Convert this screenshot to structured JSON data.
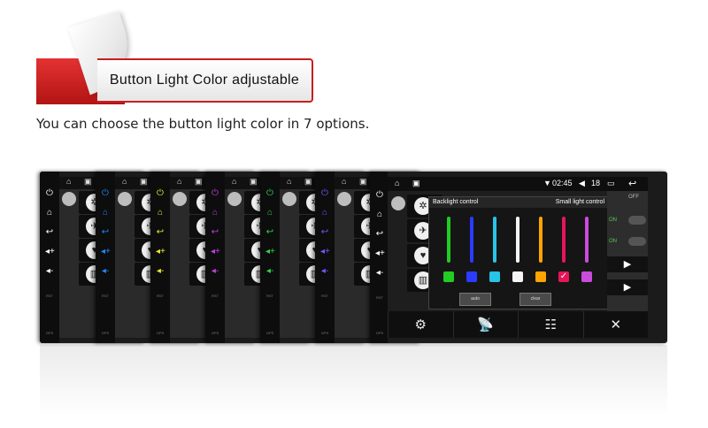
{
  "banner": {
    "title": "Button Light Color adjustable"
  },
  "subtitle": "You can choose the button light color in 7 options.",
  "button_light_colors": [
    "#ffffff",
    "#1e88ff",
    "#e8e832",
    "#c040e0",
    "#33d24a",
    "#6a5cff",
    "#ffffff"
  ],
  "bezel_labels": {
    "reset": "RST",
    "gps": "GPS"
  },
  "front_screen": {
    "status": {
      "time": "02:45",
      "volume": "18"
    },
    "dialog": {
      "title": "Backlight control",
      "mode": "Small light control",
      "bar_colors": [
        "#22cc22",
        "#2b3bff",
        "#27c4e6",
        "#f5f5f5",
        "#ffa400",
        "#e8155a",
        "#c94cdc"
      ],
      "swatch_colors": [
        "#22cc22",
        "#2b3bff",
        "#27c4e6",
        "#f5f5f5",
        "#ffa400",
        "#e8155a",
        "#c94cdc"
      ],
      "selected_swatch": 5,
      "btn_left": "auto",
      "btn_right": "clear"
    },
    "side_panel": {
      "off": "OFF",
      "on1": "ON",
      "on2": "ON"
    },
    "dock": [
      "settings-icon",
      "gps-icon",
      "equalizer-icon",
      "tools-icon"
    ]
  }
}
